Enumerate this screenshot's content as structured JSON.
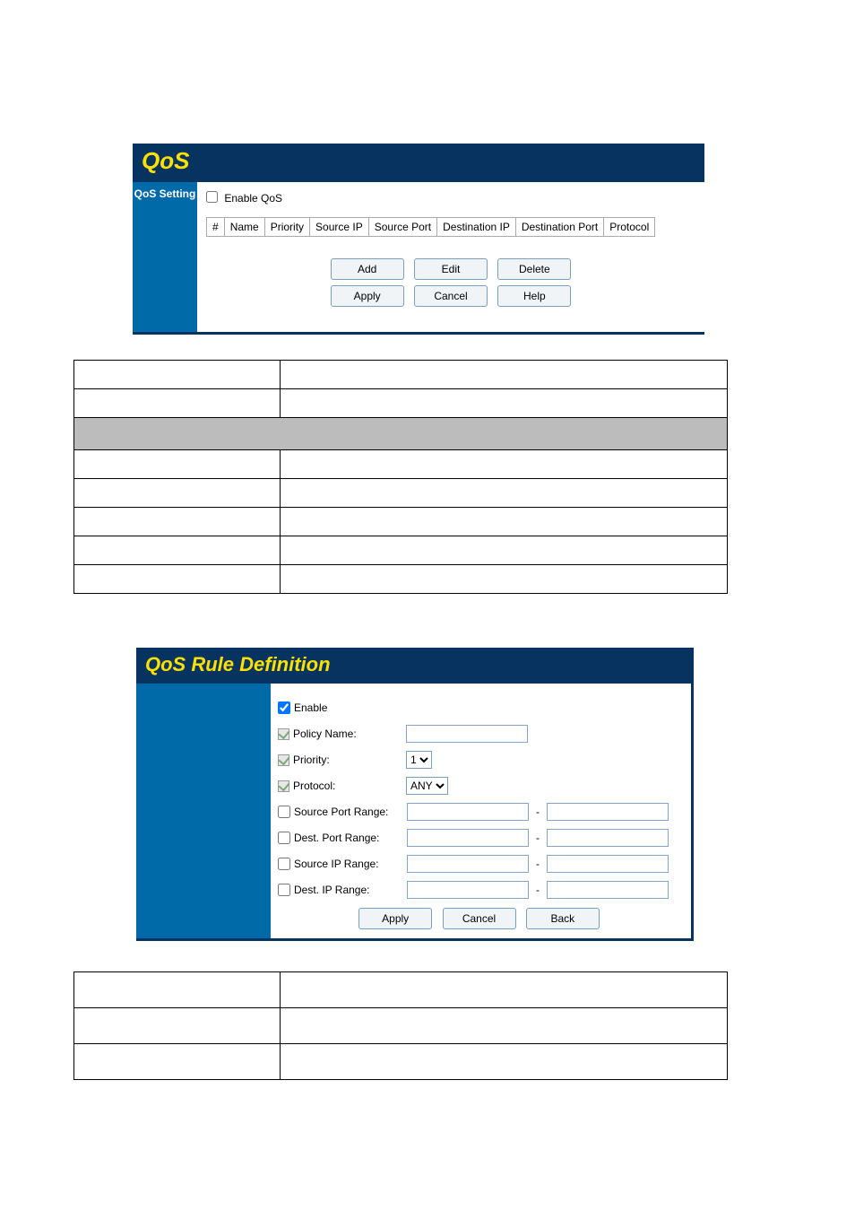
{
  "qos": {
    "title": "QoS",
    "sidebar_label": "QoS Setting",
    "enable_label": "Enable QoS",
    "columns": [
      "#",
      "Name",
      "Priority",
      "Source IP",
      "Source Port",
      "Destination IP",
      "Destination Port",
      "Protocol"
    ],
    "buttons": {
      "add": "Add",
      "edit": "Edit",
      "delete": "Delete",
      "apply": "Apply",
      "cancel": "Cancel",
      "help": "Help"
    }
  },
  "rule": {
    "title": "QoS Rule Definition",
    "fields": {
      "enable": "Enable",
      "policy_name": "Policy Name:",
      "priority": "Priority:",
      "protocol": "Protocol:",
      "src_port": "Source Port Range:",
      "dst_port": "Dest. Port Range:",
      "src_ip": "Source IP Range:",
      "dst_ip": "Dest. IP Range:"
    },
    "priority_value": "1",
    "protocol_value": "ANY",
    "buttons": {
      "apply": "Apply",
      "cancel": "Cancel",
      "back": "Back"
    }
  }
}
